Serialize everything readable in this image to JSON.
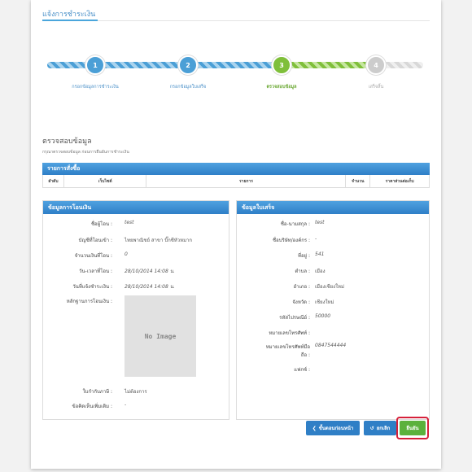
{
  "page": {
    "title": "แจ้งการชำระเงิน"
  },
  "steps": [
    {
      "num": "1",
      "label": "กรอกข้อมูลการชำระเงิน",
      "state": "done",
      "color": "#4b9fd6"
    },
    {
      "num": "2",
      "label": "กรอกข้อมูลใบเสร็จ",
      "state": "done",
      "color": "#4b9fd6"
    },
    {
      "num": "3",
      "label": "ตรวจสอบข้อมูล",
      "state": "active",
      "color": "#7fbf3a"
    },
    {
      "num": "4",
      "label": "เสร็จสิ้น",
      "state": "pending",
      "color": "#cccccc"
    }
  ],
  "section": {
    "title": "ตรวจสอบข้อมูล",
    "subtitle": "กรุณาตรวจสอบข้อมูล ก่อนการยืนยันการชำระเงิน"
  },
  "orders": {
    "title": "รายการสั่งซื้อ",
    "columns": [
      "ลำดับ",
      "เว็บไซต์",
      "รายการ",
      "จำนวน",
      "ราคาส่วนต่อเก็บ"
    ]
  },
  "transfer": {
    "title": "ข้อมูลการโอนเงิน",
    "fields": [
      {
        "label": "ชื่อผู้โอน :",
        "value": "test"
      },
      {
        "label": "บัญชีที่โอนเข้า :",
        "value": "ไทยพาณิชย์ สาขา บิ๊กซีหัวหมาก"
      },
      {
        "label": "จำนวนเงินที่โอน :",
        "value": "0"
      },
      {
        "label": "วัน-เวลาที่โอน :",
        "value": "28/10/2014 14:08 น."
      },
      {
        "label": "วันที่แจ้งชำระเงิน :",
        "value": "28/10/2014 14:08 น."
      }
    ],
    "proof_label": "หลักฐานการโอนเงิน :",
    "no_image": "No Image",
    "tax_label": "ใบกำกับภาษี :",
    "tax_value": "ไม่ต้องการ",
    "note_label": "ข้อคิดเห็นเพิ่มเติม :",
    "note_value": "-"
  },
  "receipt": {
    "title": "ข้อมูลใบเสร็จ",
    "fields": [
      {
        "label": "ชื่อ-นามสกุล :",
        "value": "test"
      },
      {
        "label": "ชื่อบริษัท/องค์กร :",
        "value": "-"
      },
      {
        "label": "ที่อยู่ :",
        "value": "541"
      },
      {
        "label": "ตำบล :",
        "value": "เมือง"
      },
      {
        "label": "อำเภอ :",
        "value": "เมืองเชียงใหม่"
      },
      {
        "label": "จังหวัด :",
        "value": "เชียงใหม่"
      },
      {
        "label": "รหัสไปรษณีย์ :",
        "value": "50000"
      },
      {
        "label": "หมายเลขโทรศัพท์ :",
        "value": ""
      },
      {
        "label": "หมายเลขโทรศัพท์มือถือ :",
        "value": "0847544444"
      },
      {
        "label": "แฟกซ์ :",
        "value": ""
      }
    ]
  },
  "buttons": {
    "back": "ขั้นตอนก่อนหน้า",
    "cancel": "ยกเลิก",
    "confirm": "ยืนยัน"
  }
}
